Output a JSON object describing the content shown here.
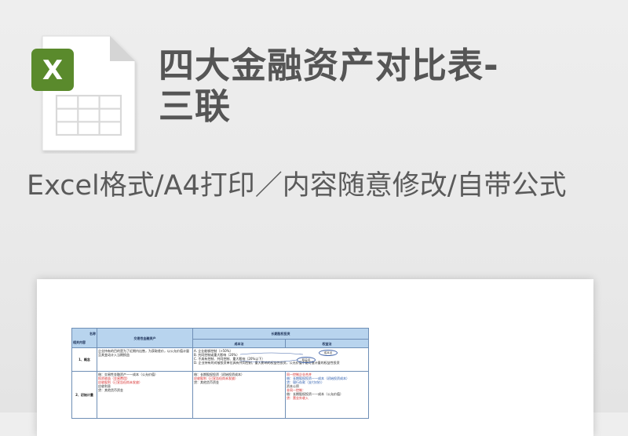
{
  "title_line1": "四大金融资产对比表-",
  "title_line2": "三联",
  "subtitle": "Excel格式/A4打印／内容随意修改/自带公式",
  "icon": {
    "name": "excel-file-icon",
    "badge_letter": "X",
    "badge_color": "#5a8a2c",
    "page_color": "#ffffff",
    "fold_color": "#d5d5d5",
    "grid_color": "#d9d9d9"
  },
  "table": {
    "corner_top": "名称",
    "corner_bottom": "相关内容",
    "col_trading": "交易性金融资产",
    "col_longterm": "长期股权投资",
    "col_cost": "成本法",
    "col_equity": "权益法",
    "row1_label": "1、概念",
    "row1_trading": "企业持有的目的是为了近期内出售，为获取差价，以公允价值计量且其变动计入当期损益",
    "row1_cost_lines": [
      "A. 企业能够控制（>50%）",
      "B. 共同控制或重大影响（20%）",
      "C. 不具有控制、共同控制、重大影响（20%以下）"
    ],
    "row1_bottom": "D. 企业持有的对被投资单位具有共同控制、重大影响的权益性投资，公允价值不能可靠计量的权益性投资",
    "oval_a": "成本法",
    "oval_b": "权益法",
    "row2_label": "2、初始计量",
    "row2_trading_lines": [
      "借：交易性金融资产——成本（公允价值）",
      "    投资收益（交易费用）",
      "    应收股利（已宣告但尚未发放）",
      "    应收利息",
      "  贷：其他货币资金"
    ],
    "row2_cost_lines": [
      "借：长期股权投资（初始投资成本）",
      "    应收股利（已宣告但尚未发放）",
      "  贷：其他货币资金"
    ],
    "row2_equity_lines": [
      "同一控制企业合并",
      "借：长期股权投资——成本（初始投资成本）",
      "  贷：银行存款（支付对价）",
      "    资本公积",
      "非同一控制：",
      "借：长期股权投资——成本（公允价值）",
      "  贷：营业外收入"
    ]
  }
}
